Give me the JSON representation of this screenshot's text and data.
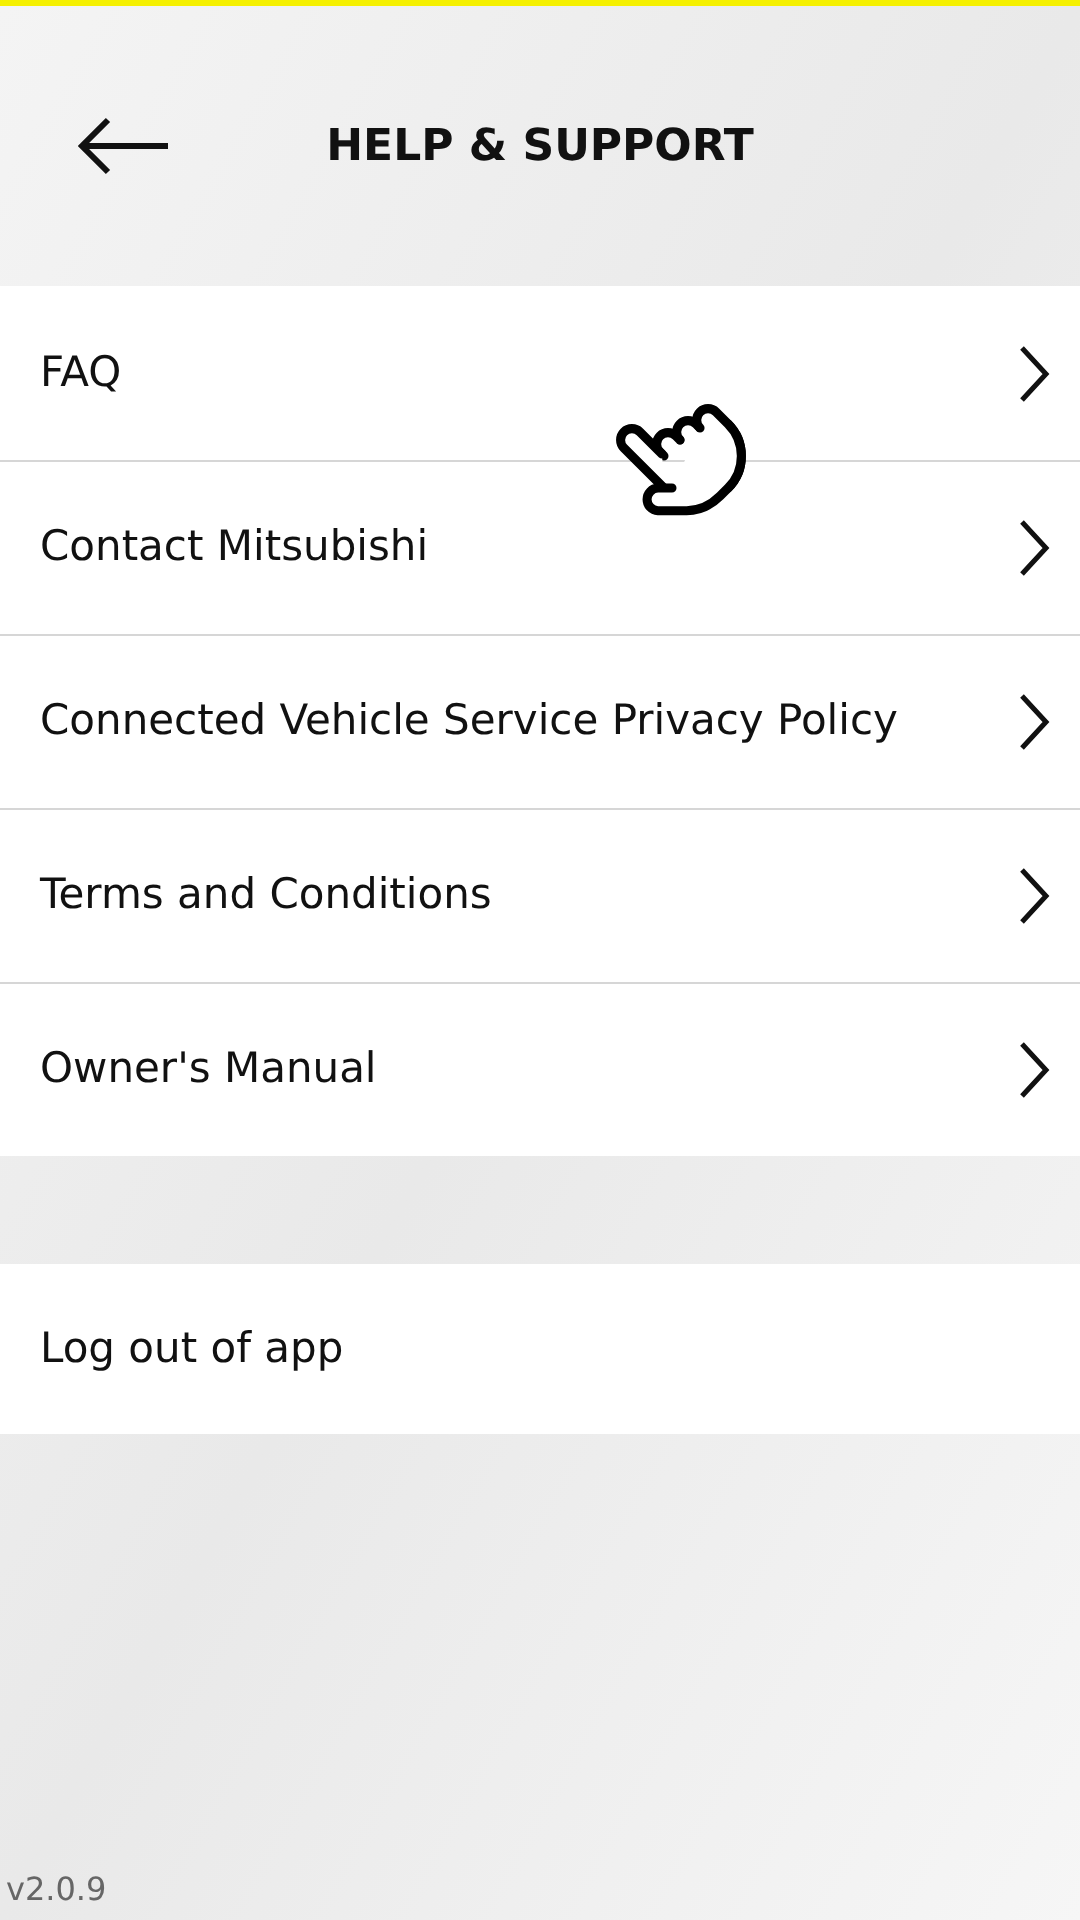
{
  "header": {
    "title": "HELP & SUPPORT"
  },
  "menu_items": [
    {
      "label": "FAQ"
    },
    {
      "label": "Contact Mitsubishi"
    },
    {
      "label": "Connected Vehicle Service Privacy Policy"
    },
    {
      "label": "Terms and Conditions"
    },
    {
      "label": "Owner's Manual"
    }
  ],
  "logout": {
    "label": "Log out of app"
  },
  "version": "v2.0.9"
}
